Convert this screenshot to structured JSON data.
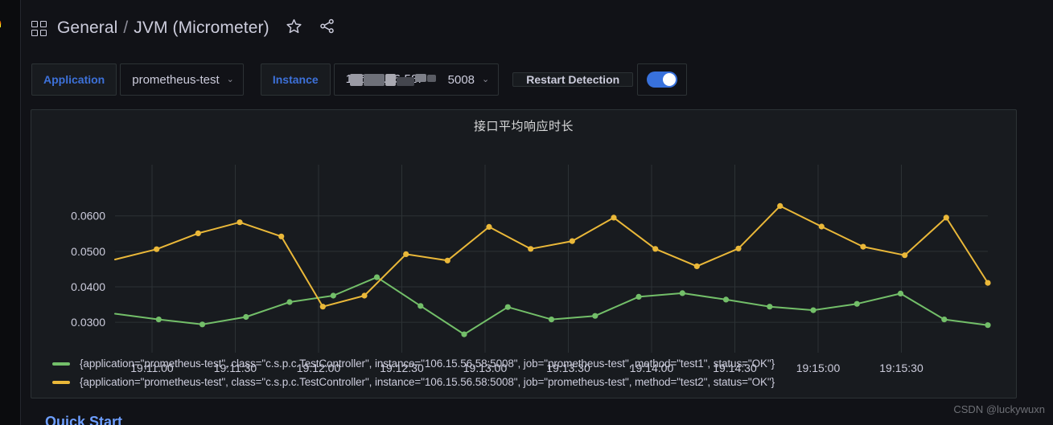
{
  "app": {
    "logo_icon": "grafana-logo-icon",
    "background": "#111217"
  },
  "header": {
    "grid_icon": "dashboard-grid-icon",
    "folder": "General",
    "separator": "/",
    "dashboard": "JVM (Micrometer)",
    "star_icon": "star-icon",
    "share_icon": "share-icon"
  },
  "variables": {
    "application": {
      "label": "Application",
      "value": "prometheus-test",
      "caret": "⌄"
    },
    "instance": {
      "label": "Instance",
      "value_visible_suffix": "5008",
      "value_masked": "106.15.56.58:",
      "caret": "⌄"
    },
    "restart_detection": {
      "label": "Restart Detection",
      "enabled": true,
      "toggle_color": "#3871dc"
    }
  },
  "panel": {
    "title": "接口平均响应时长"
  },
  "chart_data": {
    "type": "line",
    "title": "接口平均响应时长",
    "xlabel": "",
    "ylabel": "",
    "grid": true,
    "legend_position": "bottom",
    "ylim": [
      0.0255,
      0.069
    ],
    "yticks": [
      0.03,
      0.04,
      0.05,
      0.06
    ],
    "ytick_labels": [
      "0.0300",
      "0.0400",
      "0.0500",
      "0.0600"
    ],
    "xticks": [
      "19:11:00",
      "19:11:30",
      "19:12:00",
      "19:12:30",
      "19:13:00",
      "19:13:30",
      "19:14:00",
      "19:14:30",
      "19:15:00",
      "19:15:30"
    ],
    "x": [
      "19:10:45",
      "19:11:00",
      "19:11:15",
      "19:11:30",
      "19:11:45",
      "19:12:00",
      "19:12:15",
      "19:12:30",
      "19:12:45",
      "19:13:00",
      "19:13:15",
      "19:13:30",
      "19:13:45",
      "19:14:00",
      "19:14:15",
      "19:14:30",
      "19:14:45",
      "19:15:00",
      "19:15:15",
      "19:15:30",
      "19:15:45"
    ],
    "series": [
      {
        "name": "{application=\"prometheus-test\", class=\"c.s.p.c.TestController\", instance=\"106.15.56.58:5008\", job=\"prometheus-test\", method=\"test1\", status=\"OK\"}",
        "color": "#73BF69",
        "values": [
          0.0324,
          0.0308,
          0.0294,
          0.0315,
          0.0357,
          0.0375,
          0.0427,
          0.0346,
          0.0266,
          0.0343,
          0.0308,
          0.0318,
          0.0372,
          0.0382,
          0.0364,
          0.0344,
          0.0334,
          0.0352,
          0.0381,
          0.0308,
          0.0292
        ]
      },
      {
        "name": "{application=\"prometheus-test\", class=\"c.s.p.c.TestController\", instance=\"106.15.56.58:5008\", job=\"prometheus-test\", method=\"test2\", status=\"OK\"}",
        "color": "#EAB839",
        "values": [
          0.0477,
          0.0506,
          0.0551,
          0.0582,
          0.0542,
          0.0344,
          0.0375,
          0.0492,
          0.0474,
          0.0569,
          0.0507,
          0.0529,
          0.0595,
          0.0507,
          0.0458,
          0.0508,
          0.0628,
          0.057,
          0.0513,
          0.0489,
          0.0595,
          0.0411
        ]
      }
    ]
  },
  "footer": {
    "quickstart": "Quick Start",
    "watermark": "CSDN @luckywuxn"
  }
}
